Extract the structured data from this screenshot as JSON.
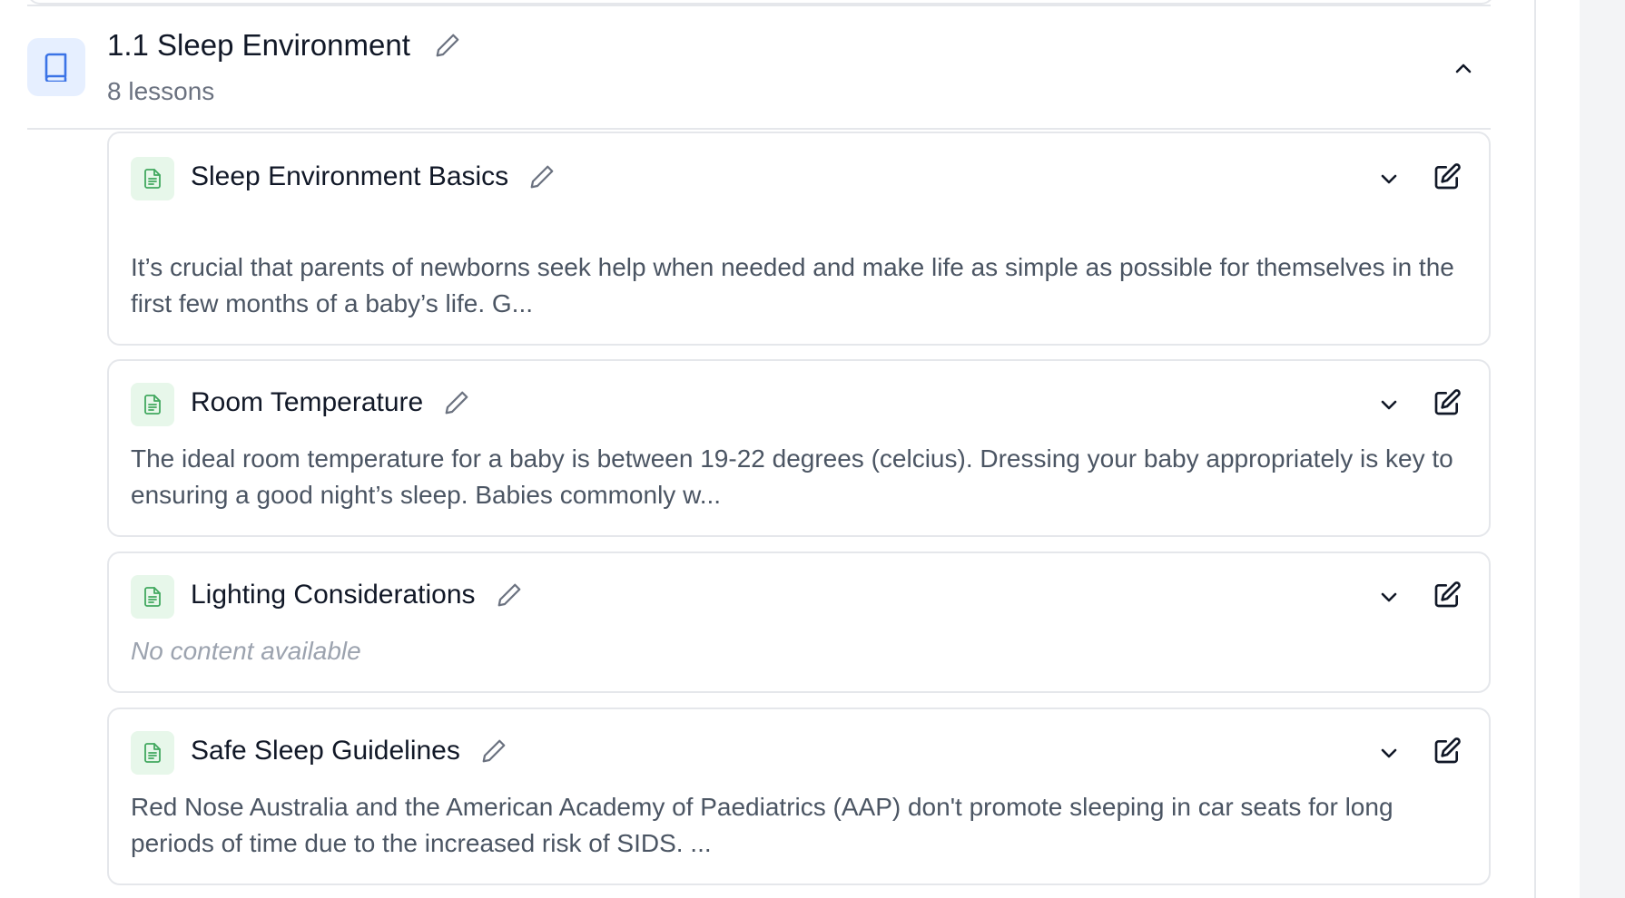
{
  "section": {
    "title": "1.1 Sleep Environment",
    "subtitle": "8 lessons",
    "icon": "book-icon"
  },
  "lessons": [
    {
      "title": "Sleep Environment Basics",
      "description": "It’s crucial that parents of newborns seek help when needed and make life as simple as possible for themselves in the first few months of a baby’s life. G...",
      "empty": false
    },
    {
      "title": "Room Temperature",
      "description": "The ideal room temperature for a baby is between 19-22 degrees (celcius). Dressing your baby appropriately is key to ensuring a good night’s sleep. Babies commonly w...",
      "empty": false
    },
    {
      "title": "Lighting Considerations",
      "description": "No content available",
      "empty": true
    },
    {
      "title": "Safe Sleep Guidelines",
      "description": "Red Nose Australia and the American Academy of Paediatrics (AAP) don't promote sleeping in car seats for long periods of time due to the increased risk of SIDS. ...",
      "empty": false
    }
  ],
  "colors": {
    "section_icon_bg": "#e6efff",
    "section_icon_fg": "#3b73e6",
    "lesson_icon_bg": "#e7f7ea",
    "lesson_icon_fg": "#41a85f",
    "border": "#e5e7eb"
  }
}
